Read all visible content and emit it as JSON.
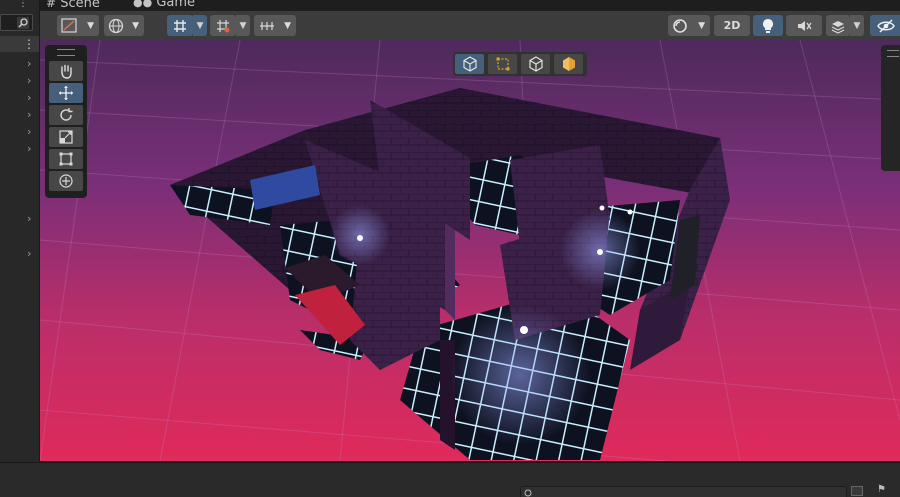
{
  "tabs": [
    {
      "label": "Scene",
      "icon": "hash-icon"
    },
    {
      "label": "Game",
      "icon": "gamepad-icon"
    }
  ],
  "toolbar": {
    "toggle_2d": "2D"
  },
  "tool_palette": [
    "hand-tool",
    "move-tool",
    "rotate-tool",
    "scale-tool",
    "rect-tool",
    "transform-tool"
  ],
  "active_tool": "move-tool",
  "colors": {
    "accent": "#46607c",
    "toolbar": "#3c3c3c",
    "grid_glow": "#bfe9ff",
    "floor": "#d62a5e",
    "wall": "#3a1e45"
  }
}
